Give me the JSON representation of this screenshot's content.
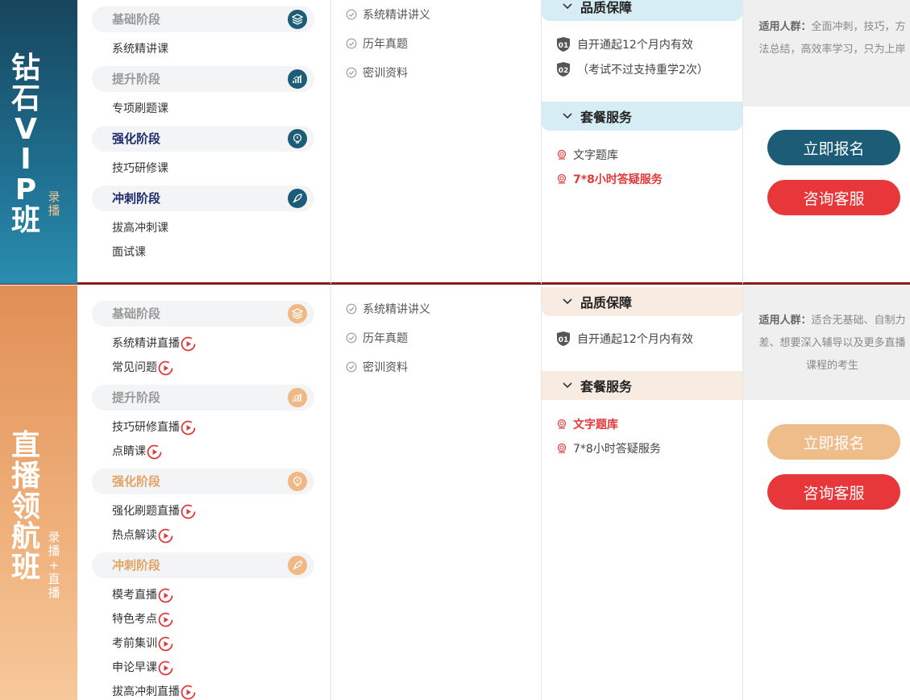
{
  "packages": [
    {
      "name": "钻石VIP班",
      "name_chars": [
        "钻",
        "石",
        "V",
        "I",
        "P",
        "班"
      ],
      "tag": "录播",
      "tag_chars": [
        "录",
        "播"
      ],
      "stages": [
        {
          "label": "基础阶段",
          "courses": [
            "系统精讲课"
          ]
        },
        {
          "label": "提升阶段",
          "courses": [
            "专项刷题课"
          ]
        },
        {
          "label": "强化阶段",
          "courses": [
            "技巧研修课"
          ]
        },
        {
          "label": "冲刺阶段",
          "courses": [
            "拔高冲刺课",
            "面试课"
          ]
        }
      ],
      "materials": [
        "系统精讲讲义",
        "历年真题",
        "密训资料"
      ],
      "guarantee_title": "品质保障",
      "guarantees": [
        {
          "num": "01",
          "text": "自开通起12个月内有效"
        },
        {
          "num": "02",
          "text": "（考试不过支持重学2次）"
        }
      ],
      "service_title": "套餐服务",
      "services": [
        {
          "text": "文字题库",
          "highlight": false
        },
        {
          "text": "7*8小时答疑服务",
          "highlight": true
        }
      ],
      "audience_label": "适用人群：",
      "audience_text": "全面冲刺，技巧，方法总结，高效率学习，只为上岸",
      "enroll_label": "立即报名",
      "consult_label": "咨询客服",
      "accent": "#1c5c77"
    },
    {
      "name": "直播领航班",
      "name_chars": [
        "直",
        "播",
        "领",
        "航",
        "班"
      ],
      "tag": "录播+直播",
      "tag_chars": [
        "录",
        "播",
        "+",
        "直",
        "播"
      ],
      "stages": [
        {
          "label": "基础阶段",
          "courses": [
            "系统精讲直播",
            "常见问题"
          ]
        },
        {
          "label": "提升阶段",
          "courses": [
            "技巧研修直播",
            "点睛课"
          ]
        },
        {
          "label": "强化阶段",
          "courses": [
            "强化刷题直播",
            "热点解读"
          ]
        },
        {
          "label": "冲刺阶段",
          "courses": [
            "模考直播",
            "特色考点",
            "考前集训",
            "申论早课",
            "拔高冲刺直播"
          ]
        }
      ],
      "materials": [
        "系统精讲讲义",
        "历年真题",
        "密训资料"
      ],
      "guarantee_title": "品质保障",
      "guarantees": [
        {
          "num": "01",
          "text": "自开通起12个月内有效"
        }
      ],
      "service_title": "套餐服务",
      "services": [
        {
          "text": "文字题库",
          "highlight": true
        },
        {
          "text": "7*8小时答疑服务",
          "highlight": false
        }
      ],
      "audience_label": "适用人群：",
      "audience_text": "适合无基础、自制力差、想要深入辅导以及更多直播课程的考生",
      "enroll_label": "立即报名",
      "consult_label": "咨询客服",
      "accent": "#efbd8a"
    }
  ],
  "icons": {
    "stage_icons": [
      "layers-icon",
      "growth-chart-icon",
      "lightbulb-head-icon",
      "rocket-icon"
    ],
    "play": "play-circle-icon",
    "check": "check-circle-icon",
    "service": "medal-icon",
    "chevron": "chevron-down-icon"
  },
  "colors": {
    "divider": "#8b1a1a",
    "red": "#e8373a",
    "vip_blue": "#1c5c77",
    "live_orange": "#efbd8a"
  }
}
